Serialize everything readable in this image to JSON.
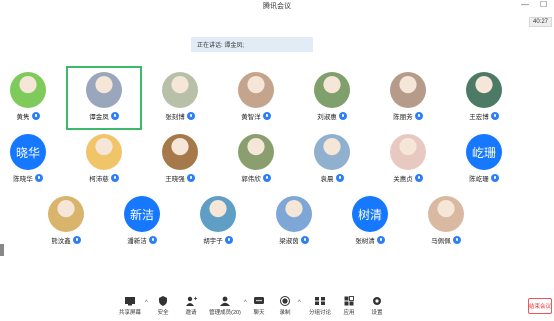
{
  "window": {
    "title": "腾讯会议",
    "minimize": "—",
    "maximize": "☐"
  },
  "timer": "40:27",
  "speaking": "正在讲话: 谭金凤;",
  "participants_row1": [
    {
      "name": "黄隽",
      "color": "#7ecb5b"
    },
    {
      "name": "谭金凤",
      "color": "#9aa6bb"
    },
    {
      "name": "张刻博",
      "color": "#b8c0a8"
    },
    {
      "name": "黄智洋",
      "color": "#c4a48c"
    },
    {
      "name": "刘淑惠",
      "color": "#7f9f6c"
    },
    {
      "name": "陈丽芳",
      "color": "#b69a8a"
    },
    {
      "name": "王宏博",
      "color": "#4d7a64"
    }
  ],
  "participants_row2": [
    {
      "name": "陈晓华",
      "avatar_text": "晓华"
    },
    {
      "name": "柯沛慈",
      "color": "#f2c46a"
    },
    {
      "name": "王晓强",
      "color": "#a5794a"
    },
    {
      "name": "郭伟欣",
      "color": "#8a9f6d"
    },
    {
      "name": "袁晨",
      "color": "#8fb1cf"
    },
    {
      "name": "关惠贞",
      "color": "#e7c9c2"
    },
    {
      "name": "陈屹珊",
      "avatar_text": "屹珊"
    }
  ],
  "participants_row3": [
    {
      "name": "熊汶鑫",
      "color": "#d9b46d"
    },
    {
      "name": "潘新洁",
      "avatar_text": "新洁"
    },
    {
      "name": "胡宇子",
      "color": "#5f9fc5"
    },
    {
      "name": "梁淑茵",
      "color": "#7ea6d6"
    },
    {
      "name": "张树清",
      "avatar_text": "树清"
    },
    {
      "name": "马佩佩",
      "color": "#d9b9a2"
    }
  ],
  "toolbar": {
    "share": "共享屏幕",
    "security": "安全",
    "invite": "邀请",
    "members": "管理成员(20)",
    "chat": "聊天",
    "record": "录制",
    "breakout": "分组讨论",
    "apps": "应用",
    "settings": "设置",
    "leave": "结束会议"
  }
}
